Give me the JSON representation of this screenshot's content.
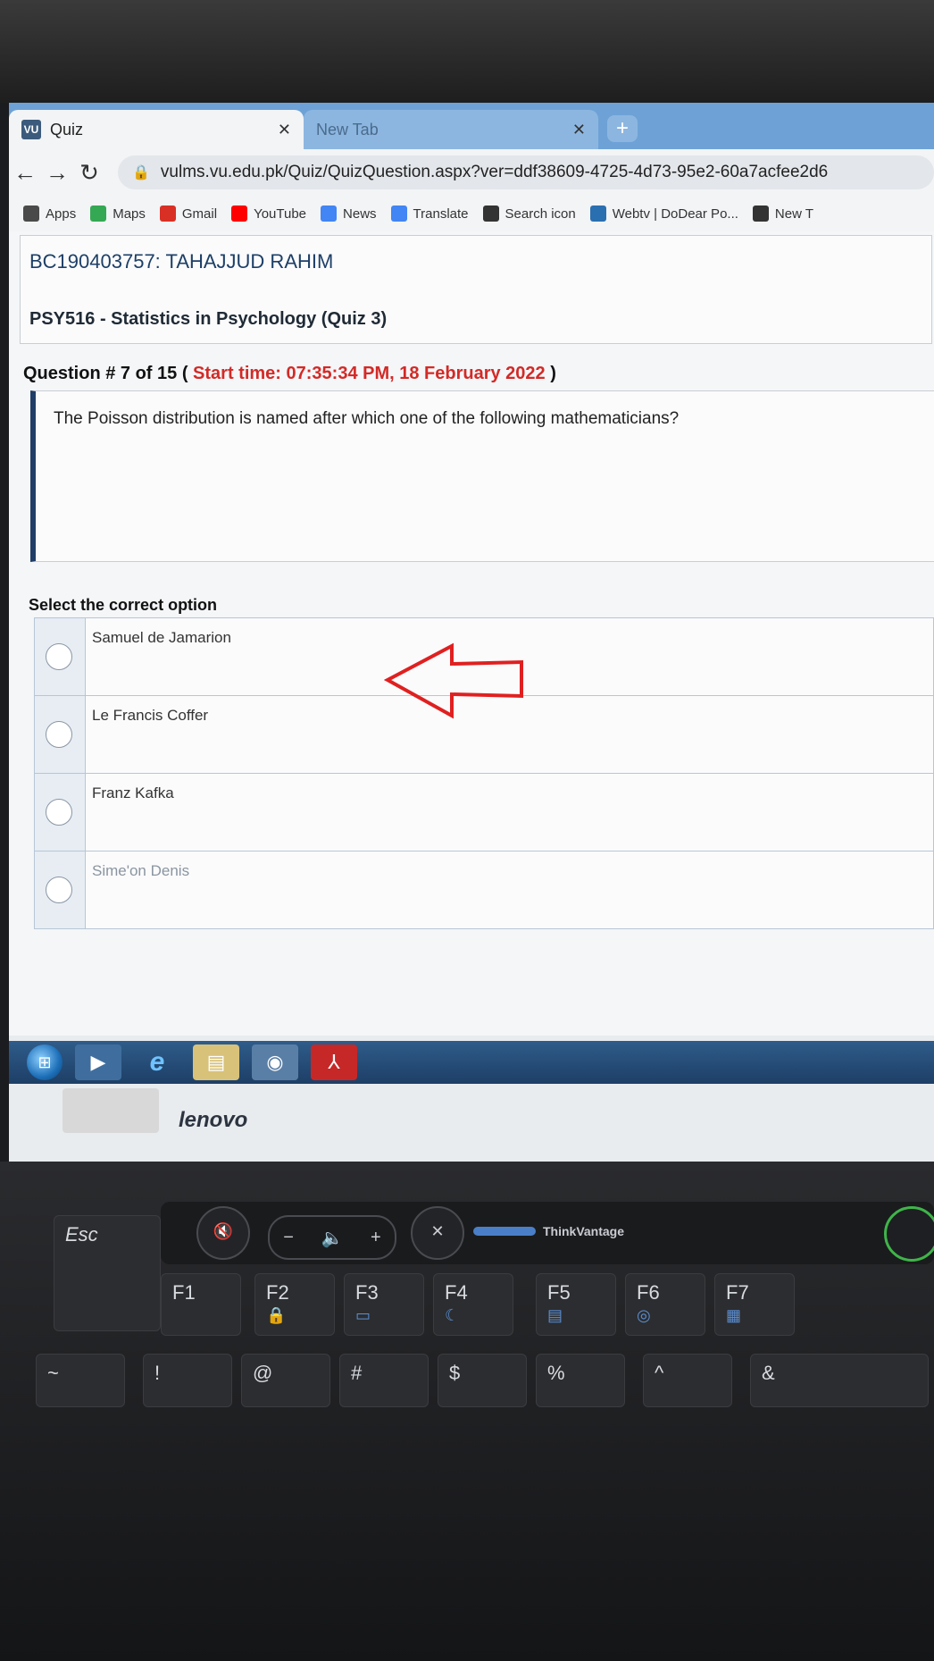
{
  "browser": {
    "tabs": [
      {
        "label": "Quiz",
        "favicon": "VU",
        "active": true
      },
      {
        "label": "New Tab",
        "active": false
      }
    ],
    "address": "vulms.vu.edu.pk/Quiz/QuizQuestion.aspx?ver=ddf38609-4725-4d73-95e2-60a7acfee2d6",
    "bookmarks": [
      {
        "label": "Apps",
        "icon": "grid-icon",
        "color": "#4a4a4a"
      },
      {
        "label": "Maps",
        "icon": "maps-icon",
        "color": "#34a853"
      },
      {
        "label": "Gmail",
        "icon": "gmail-icon",
        "color": "#d93025"
      },
      {
        "label": "YouTube",
        "icon": "youtube-icon",
        "color": "#ff0000"
      },
      {
        "label": "News",
        "icon": "news-icon",
        "color": "#4285f4"
      },
      {
        "label": "Translate",
        "icon": "translate-icon",
        "color": "#4285f4"
      },
      {
        "label": "Search icon",
        "icon": "globe-icon",
        "color": "#333333"
      },
      {
        "label": "Webtv | DoDear Po...",
        "icon": "webtv-icon",
        "color": "#2a6fb0"
      },
      {
        "label": "New T",
        "icon": "globe-icon",
        "color": "#333333"
      }
    ]
  },
  "quiz": {
    "student": "BC190403757: TAHAJJUD RAHIM",
    "course": "PSY516 - Statistics in Psychology (Quiz 3)",
    "question_label": "Question # 7 of 15 (",
    "start_time": "Start time: 07:35:34 PM, 18 February 2022",
    "question_close": ")",
    "question_text": "The Poisson distribution is named after which one of the following mathematicians?",
    "select_label": "Select the correct option",
    "options": [
      {
        "label": "Samuel de Jamarion"
      },
      {
        "label": "Le Francis Coffer"
      },
      {
        "label": "Franz Kafka"
      },
      {
        "label": "Sime'on Denis"
      }
    ],
    "annotation_color": "#e02020"
  },
  "laptop": {
    "brand": "lenovo",
    "esc": "Esc",
    "thinkvantage": "ThinkVantage",
    "fkeys": [
      {
        "label": "F1",
        "sub": ""
      },
      {
        "label": "F2",
        "sub": "🔒"
      },
      {
        "label": "F3",
        "sub": "▭"
      },
      {
        "label": "F4",
        "sub": "☾"
      },
      {
        "label": "F5",
        "sub": "▤"
      },
      {
        "label": "F6",
        "sub": "◎"
      },
      {
        "label": "F7",
        "sub": "▦"
      }
    ],
    "numkeys": [
      "~",
      "!",
      "@",
      "#",
      "$",
      "%",
      "^",
      "&"
    ]
  }
}
